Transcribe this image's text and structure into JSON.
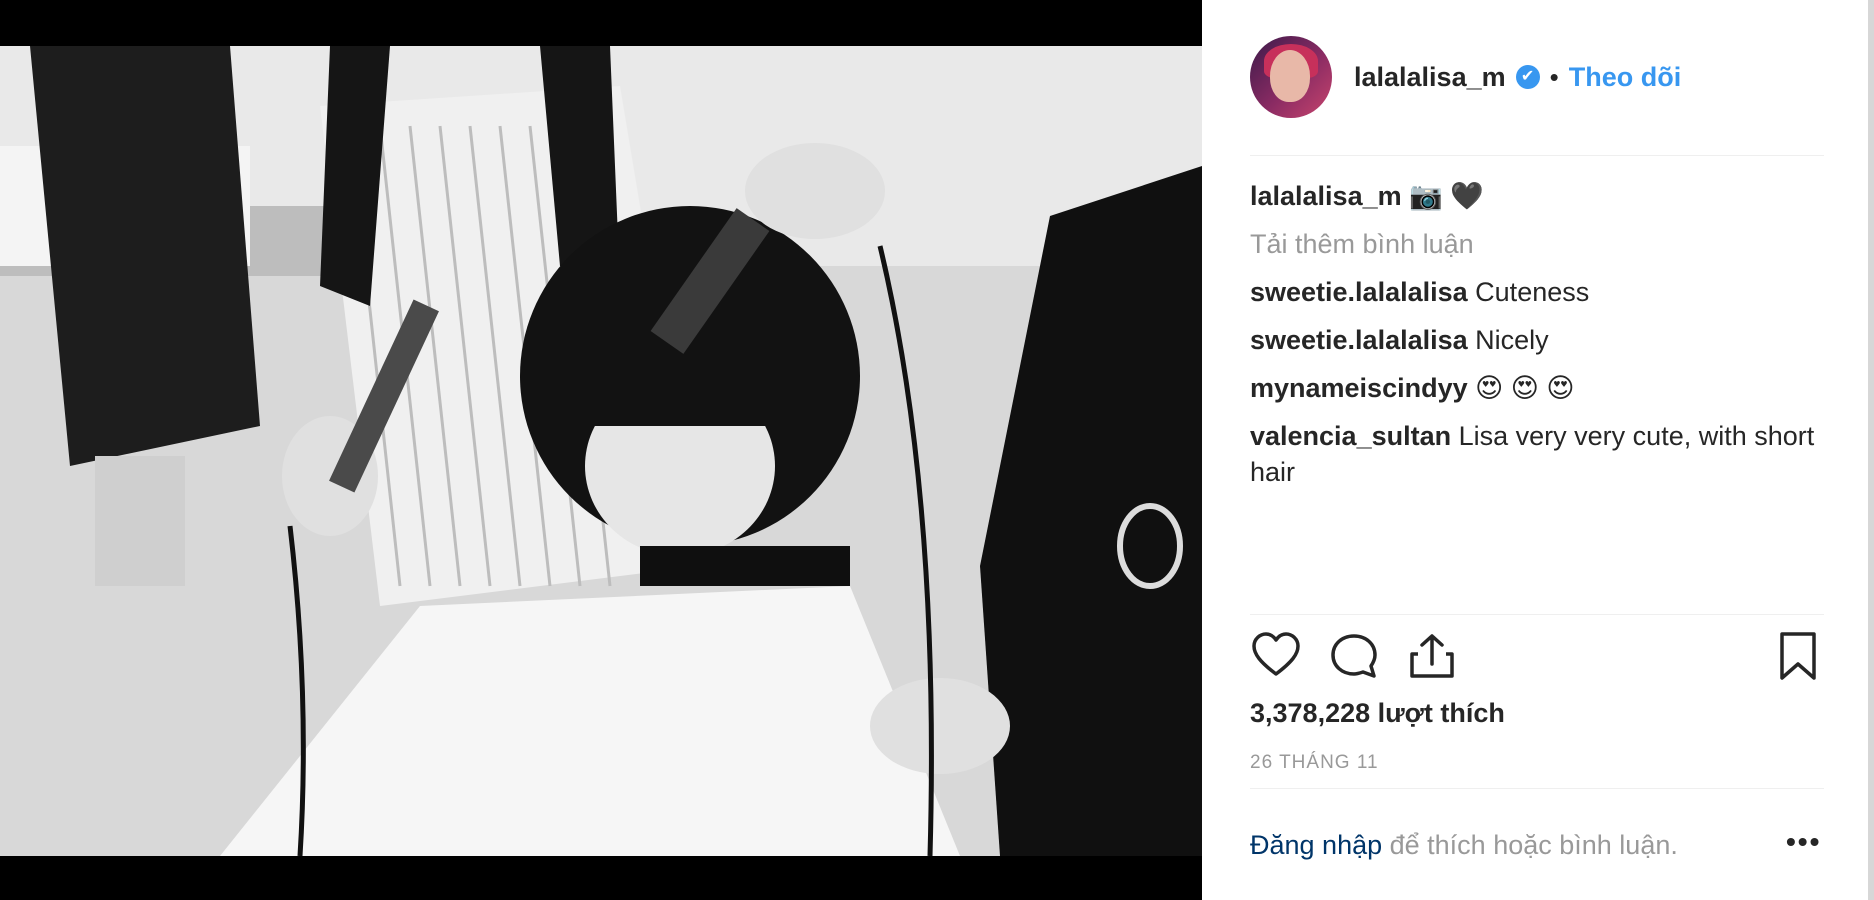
{
  "post": {
    "author": "lalalalisa_m",
    "verified_mark": "✔",
    "separator": "•",
    "follow_label": "Theo dõi",
    "caption_user": "lalalalisa_m",
    "caption_text": "📷 🖤",
    "load_more_label": "Tải thêm bình luận",
    "comments": [
      {
        "user": "sweetie.lalalalisa",
        "text": "Cuteness"
      },
      {
        "user": "sweetie.lalalalisa",
        "text": "Nicely"
      },
      {
        "user": "mynameiscindyy",
        "text": "😍 😍 😍"
      },
      {
        "user": "valencia_sultan",
        "text": "Lisa very very cute, with short hair"
      }
    ],
    "likes": "3,378,228 lượt thích",
    "date": "26 THÁNG 11",
    "login_link": "Đăng nhập",
    "login_text": " để thích hoặc bình luận.",
    "more_label": "•••"
  },
  "icons": {
    "like": "heart-icon",
    "comment": "comment-icon",
    "share": "share-icon",
    "save": "bookmark-icon",
    "verified": "verified-badge-icon",
    "more": "more-options-icon"
  },
  "colors": {
    "accent": "#3897f0",
    "text": "#262626",
    "muted": "#999999",
    "login_link": "#003569"
  }
}
